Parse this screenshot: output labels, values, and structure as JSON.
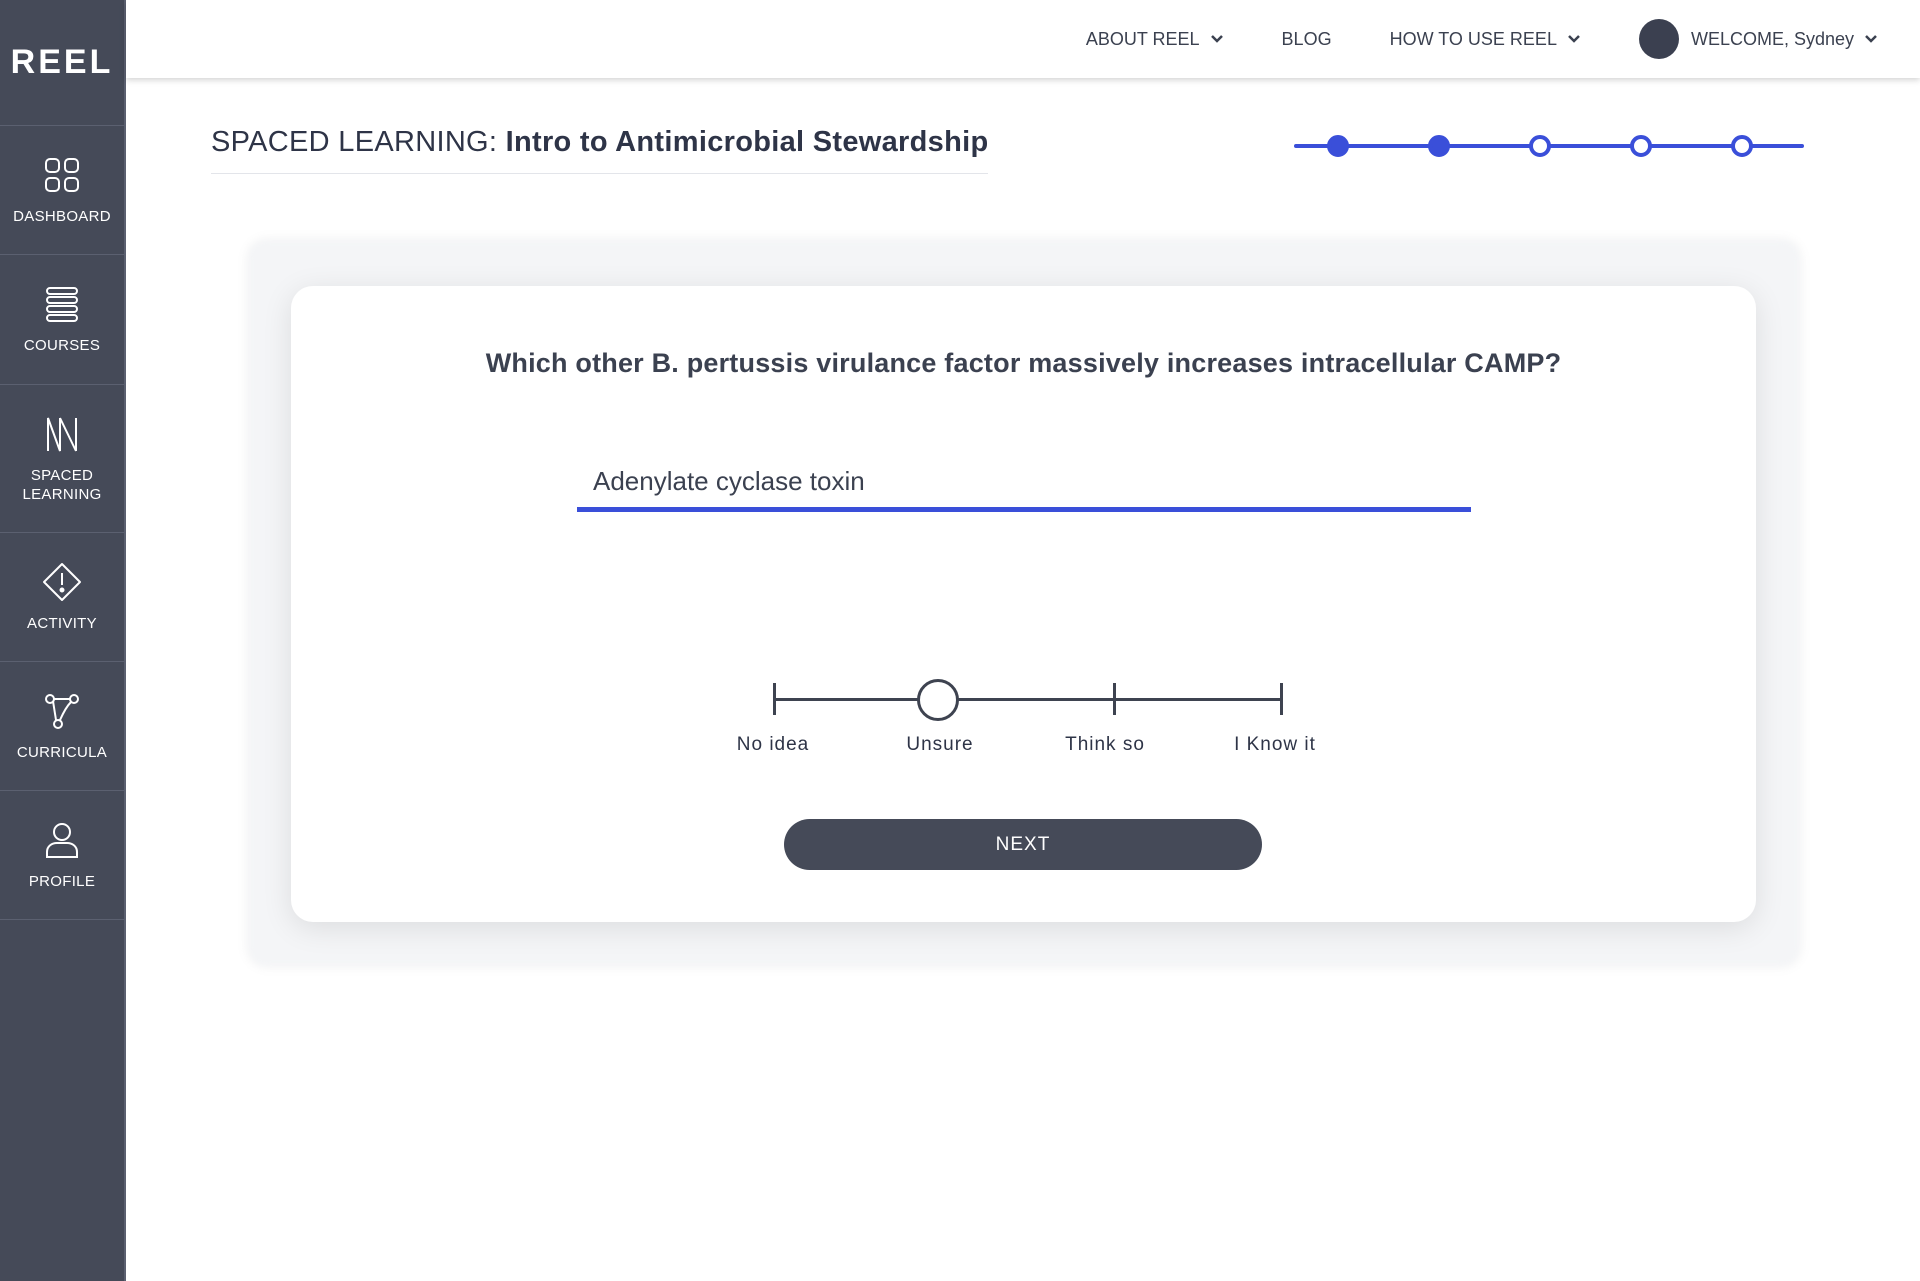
{
  "app": {
    "logo": "REEL"
  },
  "sidebar": {
    "items": [
      {
        "label": "DASHBOARD",
        "icon": "grid-icon"
      },
      {
        "label": "COURSES",
        "icon": "list-icon"
      },
      {
        "label": "SPACED\nLEARNING",
        "icon": "spaced-learning-icon"
      },
      {
        "label": "ACTIVITY",
        "icon": "alert-diamond-icon"
      },
      {
        "label": "CURRICULA",
        "icon": "nodes-icon"
      },
      {
        "label": "PROFILE",
        "icon": "user-icon"
      }
    ]
  },
  "header": {
    "about": "ABOUT REEL",
    "blog": "BLOG",
    "how_to": "HOW TO USE REEL",
    "welcome": "WELCOME, Sydney"
  },
  "page": {
    "title_prefix": "SPACED LEARNING:",
    "title_course": "Intro to Antimicrobial Stewardship"
  },
  "progress": {
    "total_steps": 5,
    "completed_steps": 2,
    "accent": "#3a4fd9"
  },
  "card": {
    "question": "Which other B. pertussis virulance factor massively increases intracellular CAMP?",
    "answer": "Adenylate cyclase toxin",
    "confidence": {
      "options": [
        "No idea",
        "Unsure",
        "Think so",
        "I Know it"
      ],
      "selected": "Unsure"
    },
    "next_label": "NEXT"
  },
  "colors": {
    "sidebar": "#454a58",
    "accent": "#3a4fd9",
    "text": "#3b4150"
  }
}
